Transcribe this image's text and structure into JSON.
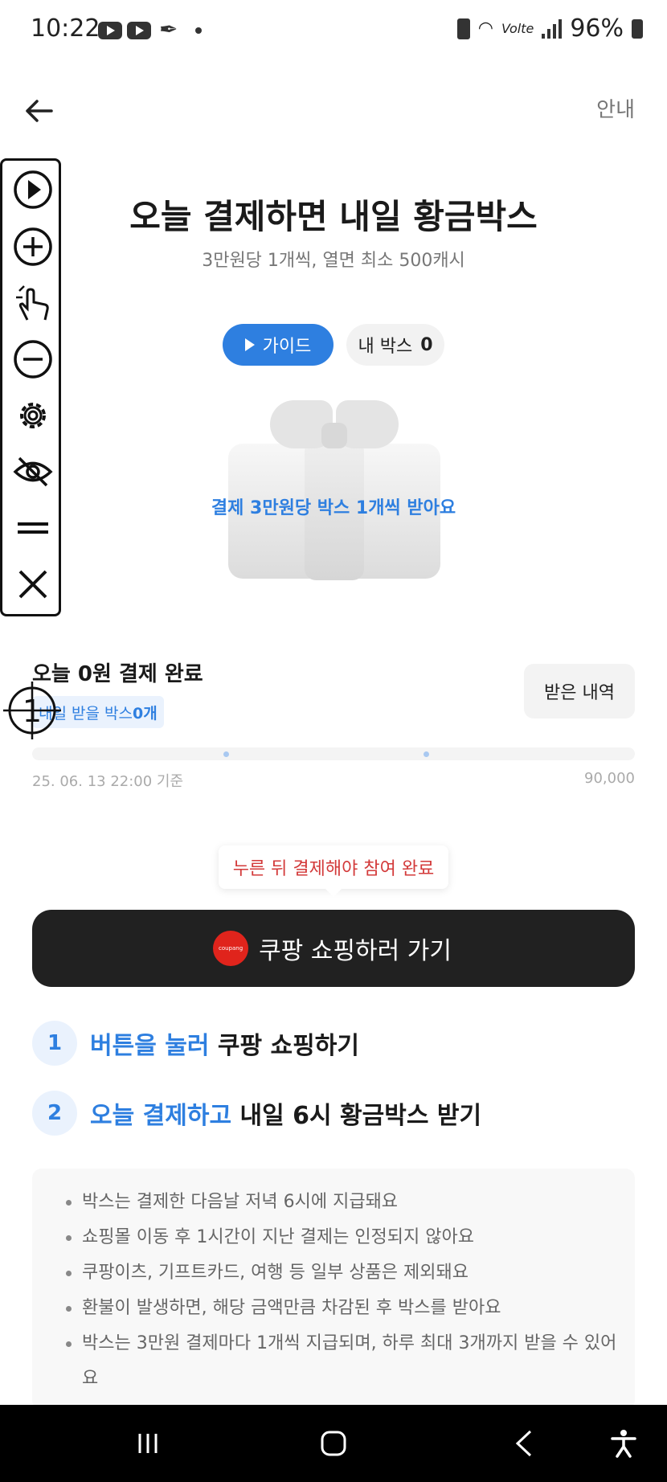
{
  "status_bar": {
    "time": "10:22",
    "battery": "96%",
    "network": "Volte"
  },
  "header": {
    "info_label": "안내"
  },
  "hero": {
    "title": "오늘 결제하면 내일 황금박스",
    "subtitle": "3만원당 1개씩, 열면 최소 500캐시"
  },
  "chips": {
    "guide_label": "가이드",
    "mybox_label": "내 박스",
    "mybox_count": "0"
  },
  "gift": {
    "label": "결제 3만원당 박스 1개씩 받아요"
  },
  "toolbar": {
    "icons": [
      "play-icon",
      "zoom-in-icon",
      "tap-gesture-icon",
      "zoom-out-icon",
      "gear-icon",
      "eye-off-icon",
      "drag-handle-icon",
      "close-icon"
    ],
    "marker": "1"
  },
  "payment": {
    "title": "오늘 0원 결제 완료",
    "tomorrow_prefix": "내일 받을 박스 ",
    "tomorrow_count": "0개",
    "history_label": "받은 내역",
    "progress": 0,
    "timestamp": "25. 06. 13 22:00 기준",
    "max_value": "90,000"
  },
  "cta": {
    "tooltip": "누른 뒤 결제해야 참여 완료",
    "brand_badge": "coupang",
    "label": "쿠팡 쇼핑하러 가기"
  },
  "steps": [
    {
      "num": "1",
      "highlight": "버튼을 눌러",
      "rest": " 쿠팡 쇼핑하기"
    },
    {
      "num": "2",
      "highlight": "오늘 결제하고",
      "rest": " 내일 6시 황금박스 받기"
    }
  ],
  "notices": [
    "박스는 결제한 다음날 저녁 6시에 지급돼요",
    "쇼핑몰 이동 후 1시간이 지난 결제는 인정되지 않아요",
    "쿠팡이츠, 기프트카드, 여행 등 일부 상품은 제외돼요",
    "환불이 발생하면, 해당 금액만큼 차감된 후 박스를 받아요",
    "박스는 3만원 결제마다 1개씩 지급되며, 하루 최대 3개까지 받을 수 있어요"
  ],
  "nav": {
    "icons": [
      "recent-apps-icon",
      "home-icon",
      "back-nav-icon",
      "accessibility-icon"
    ]
  }
}
